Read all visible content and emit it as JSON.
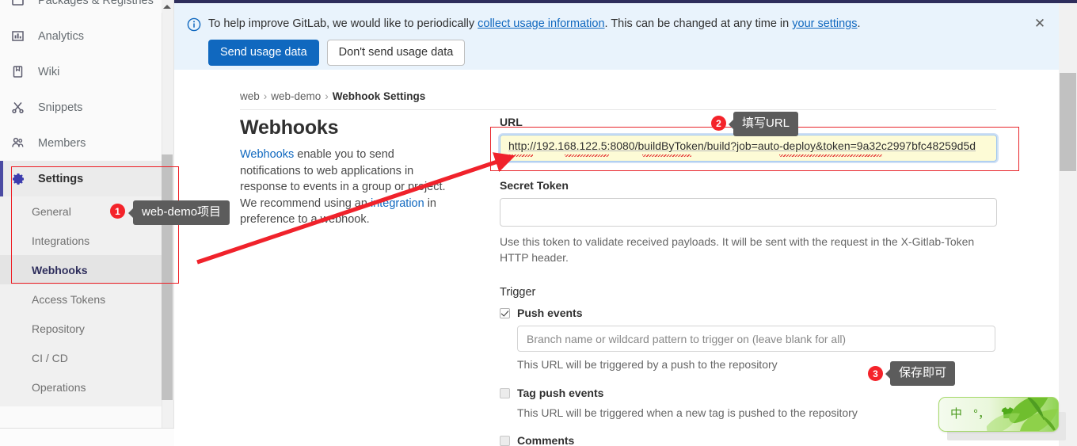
{
  "sidebar": {
    "items": [
      {
        "label": "Packages & Registries",
        "icon": "package-icon"
      },
      {
        "label": "Analytics",
        "icon": "chart-bar-icon"
      },
      {
        "label": "Wiki",
        "icon": "book-icon"
      },
      {
        "label": "Snippets",
        "icon": "scissors-icon"
      },
      {
        "label": "Members",
        "icon": "users-icon"
      },
      {
        "label": "Settings",
        "icon": "gear-icon"
      }
    ],
    "settings_sub_items": [
      {
        "label": "General"
      },
      {
        "label": "Integrations"
      },
      {
        "label": "Webhooks"
      },
      {
        "label": "Access Tokens"
      },
      {
        "label": "Repository"
      },
      {
        "label": "CI / CD"
      },
      {
        "label": "Operations"
      }
    ],
    "selected_sub_item": "Webhooks"
  },
  "banner": {
    "icon": "info-circle-icon",
    "text_before_link": "To help improve GitLab, we would like to periodically ",
    "link1": "collect usage information",
    "text_middle": ". This can be changed at any time in ",
    "link2": "your settings",
    "text_after": ".",
    "primary_button": "Send usage data",
    "secondary_button": "Don't send usage data",
    "close_icon": "close-icon",
    "close_glyph": "✕"
  },
  "breadcrumb": {
    "item1": "web",
    "item2": "web-demo",
    "current": "Webhook Settings",
    "separator": "›"
  },
  "webhooks": {
    "title": "Webhooks",
    "desc_link": "Webhooks",
    "desc_part1": " enable you to send notifications to web applications in response to events in a group or project. We recommend using an ",
    "desc_link2": "integration",
    "desc_part2": " in preference to a webhook.",
    "url_label": "URL",
    "url_value": "http://192.168.122.5:8080/buildByToken/build?job=auto-deploy&token=9a32c2997bfc48259d5d",
    "secret_token_label": "Secret Token",
    "secret_token_value": "",
    "secret_token_help": "Use this token to validate received payloads. It will be sent with the request in the X-Gitlab-Token HTTP header.",
    "trigger_label": "Trigger",
    "triggers": [
      {
        "label": "Push events",
        "checked": true,
        "input_placeholder": "Branch name or wildcard pattern to trigger on (leave blank for all)",
        "input_value": "",
        "help": "This URL will be triggered by a push to the repository"
      },
      {
        "label": "Tag push events",
        "checked": false,
        "help": "This URL will be triggered when a new tag is pushed to the repository"
      },
      {
        "label": "Comments",
        "checked": false,
        "help": ""
      }
    ]
  },
  "annotations": [
    {
      "number": "1",
      "tooltip": "web-demo项目"
    },
    {
      "number": "2",
      "tooltip": "填写URL"
    },
    {
      "number": "3",
      "tooltip": "保存即可"
    }
  ],
  "ime": {
    "mode": "中",
    "punctuation": "°，",
    "toolbox_icon": "shirt-icon"
  },
  "colors": {
    "accent_blue": "#1068bf",
    "annotation_red": "#f4232a",
    "highlight_red": "#ee1d24",
    "url_field_bg": "#fdfbd6",
    "sidebar_active": "#4b4ba3",
    "banner_bg": "#e9f3fc"
  }
}
